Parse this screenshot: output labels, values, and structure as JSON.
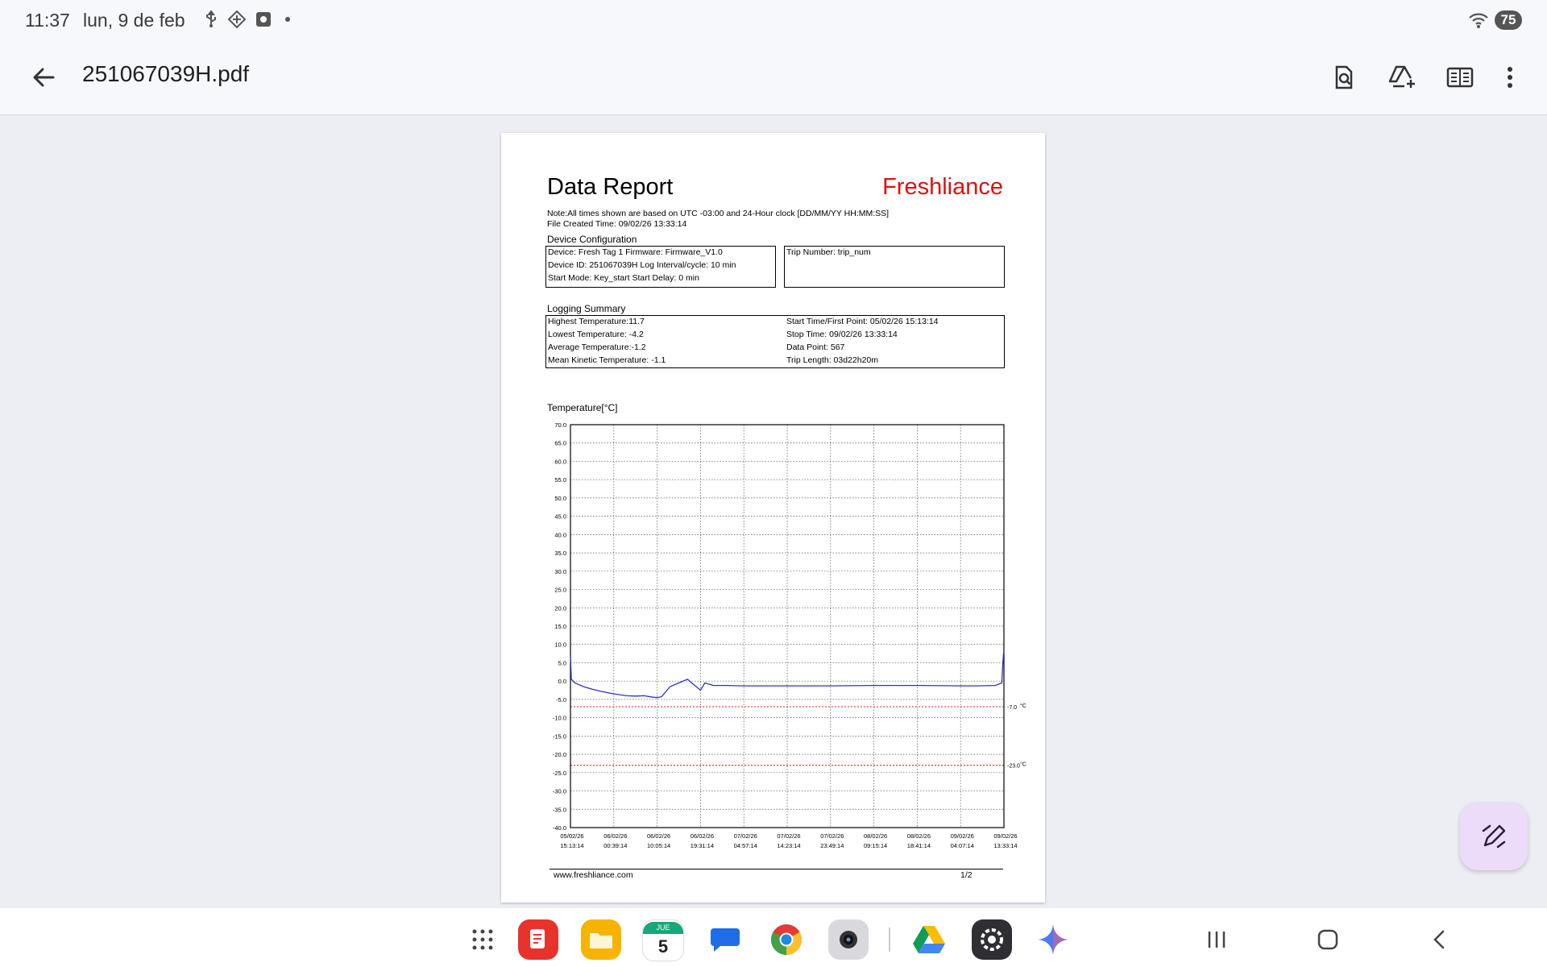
{
  "status_bar": {
    "time": "11:37",
    "date": "lun, 9 de feb",
    "battery": "75",
    "icons": [
      "usb-icon",
      "vpn-icon",
      "screen-record-icon",
      "dot-icon",
      "wifi-icon",
      "battery-icon"
    ]
  },
  "app_bar": {
    "title": "251067039H.pdf",
    "icons": [
      "back-arrow-icon",
      "find-in-document-icon",
      "add-to-drive-icon",
      "reading-mode-icon",
      "more-vert-icon"
    ]
  },
  "document": {
    "title": "Data Report",
    "brand": "Freshliance",
    "note": "Note:All times shown are based on UTC -03:00   and 24-Hour clock   [DD/MM/YY HH:MM:SS]",
    "file_created": "File Created Time: 09/02/26 13:33:14",
    "device_config": {
      "heading": "Device Configuration",
      "line1": "Device:  Fresh Tag 1      Firmware: Firmware_V1.0",
      "line2": "Device ID: 251067039H Log Interval/cycle:  10 min",
      "line3": "Start Mode: Key_start     Start Delay:  0 min",
      "trip": "Trip Number: trip_num"
    },
    "logging_summary": {
      "heading": "Logging Summary",
      "left": [
        "Highest Temperature:11.7",
        "Lowest Temperature: -4.2",
        "Average Temperature:-1.2",
        "Mean Kinetic Temperature: -1.1"
      ],
      "right": [
        "Start Time/First Point: 05/02/26 15:13:14",
        "Stop Time: 09/02/26 13:33:14",
        "Data Point: 567",
        "Trip Length:  03d22h20m"
      ]
    },
    "footer_url": "www.freshliance.com",
    "page_number": "1/2"
  },
  "chart_data": {
    "type": "line",
    "ylabel": "Temperature[°C]",
    "ylim": [
      -40,
      70
    ],
    "y_ticks": [
      "70.0",
      "65.0",
      "60.0",
      "55.0",
      "50.0",
      "45.0",
      "40.0",
      "35.0",
      "30.0",
      "25.0",
      "20.0",
      "15.0",
      "10.0",
      "5.0",
      "0.0",
      "-5.0",
      "-10.0",
      "-15.0",
      "-20.0",
      "-25.0",
      "-30.0",
      "-35.0",
      "-40.0"
    ],
    "x_ticks": [
      {
        "date": "05/02/26",
        "time": "15:13:14"
      },
      {
        "date": "06/02/26",
        "time": "00:39:14"
      },
      {
        "date": "06/02/26",
        "time": "10:05:14"
      },
      {
        "date": "06/02/26",
        "time": "19:31:14"
      },
      {
        "date": "07/02/26",
        "time": "04:57:14"
      },
      {
        "date": "07/02/26",
        "time": "14:23:14"
      },
      {
        "date": "07/02/26",
        "time": "23:49:14"
      },
      {
        "date": "08/02/26",
        "time": "09:15:14"
      },
      {
        "date": "08/02/26",
        "time": "18:41:14"
      },
      {
        "date": "09/02/26",
        "time": "04:07:14"
      },
      {
        "date": "09/02/26",
        "time": "13:33:14"
      }
    ],
    "grid": true,
    "thresholds": [
      {
        "value": -7.0,
        "label": "-7.0",
        "unit": "°C",
        "color": "#e02020"
      },
      {
        "value": -23.0,
        "label": "-23.0",
        "unit": "°C",
        "color": "#e02020"
      }
    ],
    "series": [
      {
        "color": "#3030c8",
        "x_index": [
          0,
          0.02,
          0.1,
          0.3,
          0.5,
          0.7,
          1.0,
          1.3,
          1.5,
          1.7,
          1.9,
          2.0,
          2.1,
          2.3,
          2.5,
          2.7,
          2.8,
          2.9,
          3.0,
          3.1,
          3.3,
          3.6,
          4.0,
          5.0,
          6.0,
          7.0,
          8.0,
          9.0,
          9.4,
          9.8,
          9.95,
          9.97,
          9.99,
          10.0
        ],
        "y": [
          7.0,
          0.5,
          -0.5,
          -1.5,
          -2.2,
          -2.8,
          -3.5,
          -4.0,
          -4.1,
          -4.0,
          -4.4,
          -4.5,
          -4.3,
          -1.5,
          -0.5,
          0.5,
          -0.5,
          -1.5,
          -2.5,
          -0.5,
          -1.2,
          -1.2,
          -1.3,
          -1.3,
          -1.3,
          -1.2,
          -1.2,
          -1.3,
          -1.3,
          -1.2,
          -0.5,
          4.0,
          7.5,
          8.0
        ]
      }
    ]
  },
  "dock": {
    "apps": [
      "app-drawer-icon",
      "notes-app-icon",
      "files-app-icon",
      "calendar-app-icon",
      "messages-app-icon",
      "chrome-app-icon",
      "camera-app-icon",
      "drive-app-icon",
      "settings-app-icon",
      "gemini-app-icon"
    ],
    "calendar_month": "JUE",
    "calendar_day": "5",
    "nav": [
      "recents-nav-icon",
      "home-nav-icon",
      "back-nav-icon"
    ]
  },
  "fab": {
    "icon": "edit-pen-icon"
  },
  "colors": {
    "brand_red": "#e0100f",
    "series_blue": "#3030c8",
    "threshold_red": "#e02020",
    "fab_bg": "#ecdcfa"
  }
}
